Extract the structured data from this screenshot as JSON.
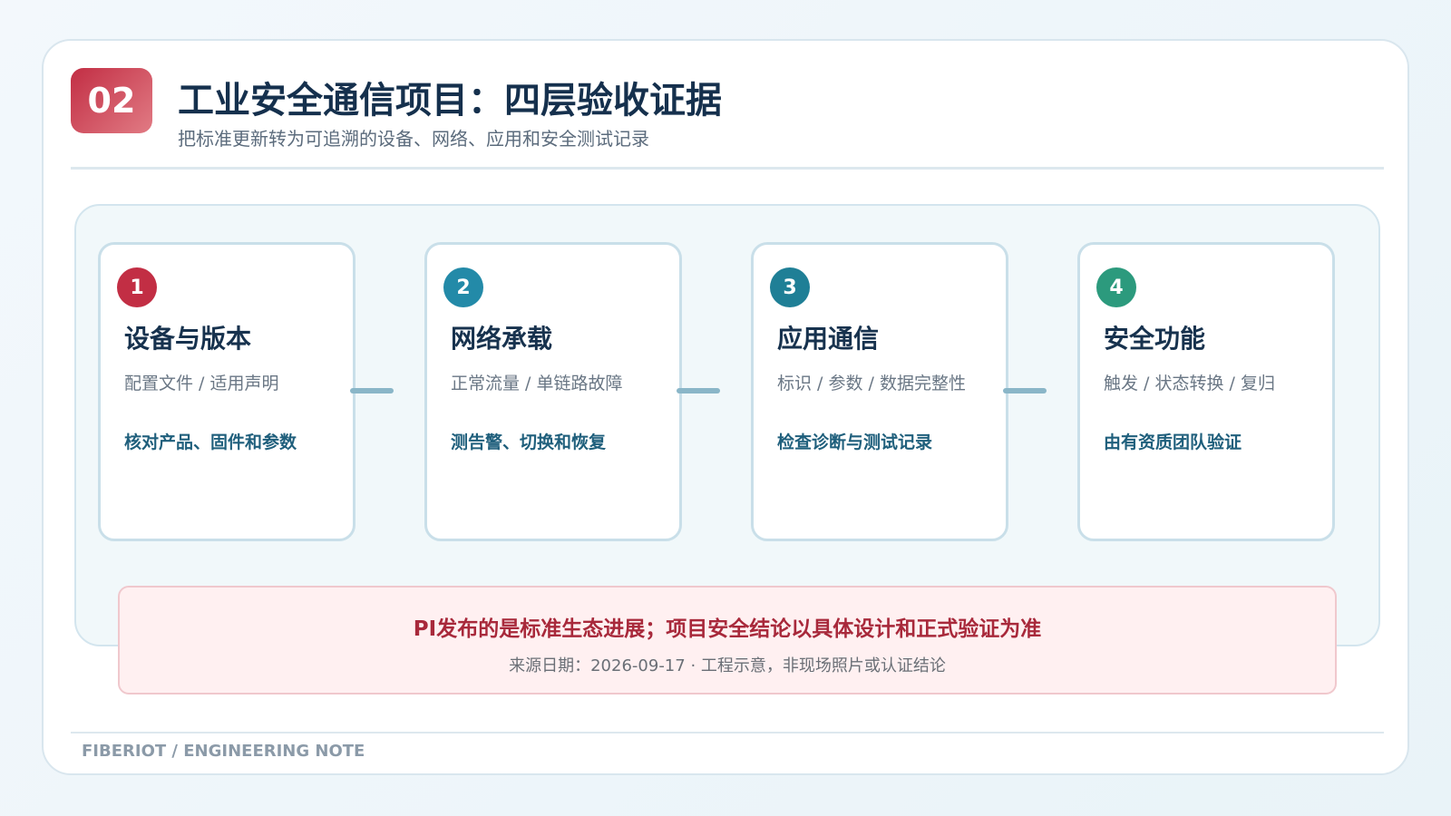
{
  "header": {
    "number": "02",
    "title": "工业安全通信项目：四层验收证据",
    "subtitle": "把标准更新转为可追溯的设备、网络、应用和安全测试记录"
  },
  "cards": [
    {
      "step": "1",
      "title": "设备与版本",
      "desc": "配置文件 / 适用声明",
      "action": "核对产品、固件和参数",
      "color": "#c22e44"
    },
    {
      "step": "2",
      "title": "网络承载",
      "desc": "正常流量 / 单链路故障",
      "action": "测告警、切换和恢复",
      "color": "#238aa8"
    },
    {
      "step": "3",
      "title": "应用通信",
      "desc": "标识 / 参数 / 数据完整性",
      "action": "检查诊断与测试记录",
      "color": "#1f7f96"
    },
    {
      "step": "4",
      "title": "安全功能",
      "desc": "触发 / 状态转换 / 复归",
      "action": "由有资质团队验证",
      "color": "#2c9a7d"
    }
  ],
  "note": {
    "main": "PI发布的是标准生态进展；项目安全结论以具体设计和正式验证为准",
    "sub": "来源日期：2026-09-17 · 工程示意，非现场照片或认证结论"
  },
  "footer": "FIBERIOT / ENGINEERING NOTE"
}
